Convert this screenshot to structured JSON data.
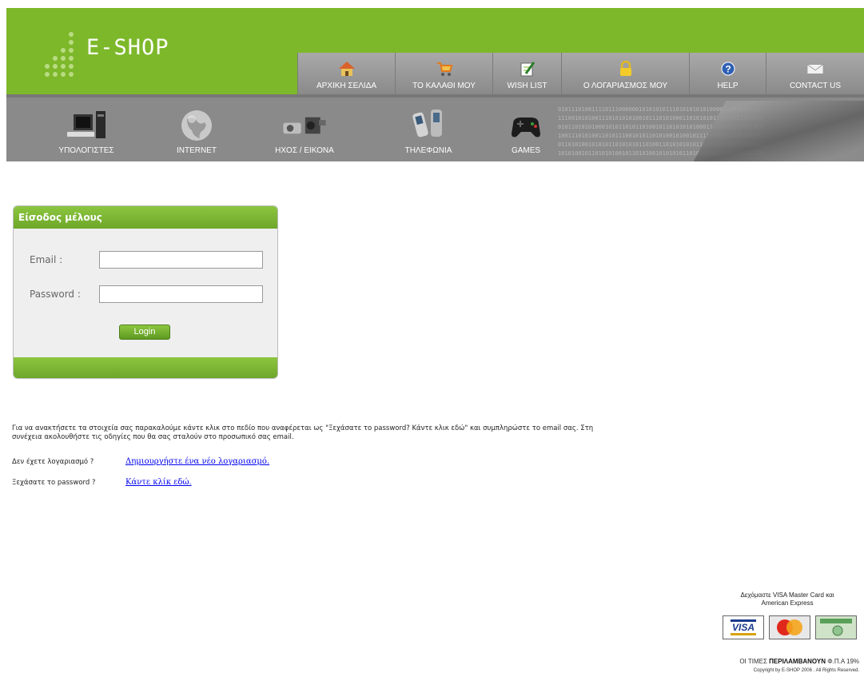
{
  "brand": {
    "name": "E-SHOP"
  },
  "top_nav": [
    {
      "label": "ΑΡΧΙΚΗ ΣΕΛΙΔΑ",
      "icon": "home-icon"
    },
    {
      "label": "ΤΟ ΚΑΛΑΘΙ ΜΟΥ",
      "icon": "cart-icon"
    },
    {
      "label": "WISH LIST",
      "icon": "wishlist-icon"
    },
    {
      "label": "Ο ΛΟΓΑΡΙΑΣΜΟΣ ΜΟΥ",
      "icon": "lock-icon"
    },
    {
      "label": "HELP",
      "icon": "help-icon"
    },
    {
      "label": "CONTACT US",
      "icon": "envelope-icon"
    }
  ],
  "categories": [
    {
      "label": "ΥΠΟΛΟΓΙΣΤΕΣ",
      "icon": "computer-icon"
    },
    {
      "label": "INTERNET",
      "icon": "globe-icon"
    },
    {
      "label": "ΗΧΟΣ / ΕΙΚΟΝΑ",
      "icon": "camera-icon"
    },
    {
      "label": "ΤΗΛΕΦΩΝΙΑ",
      "icon": "phone-icon"
    },
    {
      "label": "GAMES",
      "icon": "gamepad-icon"
    }
  ],
  "login": {
    "title": "Είσοδος μέλους",
    "email_label": "Email :",
    "password_label": "Password :",
    "email_value": "",
    "password_value": "",
    "button": "Login"
  },
  "info_text": "Για να ανακτήσετε τα στοιχεία σας παρακαλούμε κάντε κλικ στο πεδίο που αναφέρεται ως \"Ξεχάσατε το password? Κάντε κλικ εδώ\" και συμπληρώστε το email σας. Στη συνέχεια ακολουθήστε τις οδηγίες που θα σας σταλούν στο προσωπικό σας email.",
  "no_account": {
    "label": "Δεν έχετε λογαριασμό ?",
    "link": "Δημιουργήστε ένα νέο λογαριασμό."
  },
  "forgot": {
    "label": "Ξεχάσατε το password ?",
    "link": "Κάντε κλίκ εδώ."
  },
  "footer": {
    "accept_line1": "Δεχόμαστε VISA Master Card και",
    "accept_line2": "American Express",
    "cards": [
      "VISA",
      "MasterCard",
      "American Express"
    ],
    "prices_prefix": "ΟΙ ΤΙΜΕΣ",
    "prices_bold": "ΠΕΡΙΛΑΜΒΑΝΟΥΝ",
    "prices_suffix": "Φ.Π.Α 19%",
    "copyright": "Copyright by E-SHOP  2006 . All Rights Reserved."
  },
  "colors": {
    "green": "#7db82a",
    "gray": "#8a8a8a",
    "link": "#0000ee"
  }
}
